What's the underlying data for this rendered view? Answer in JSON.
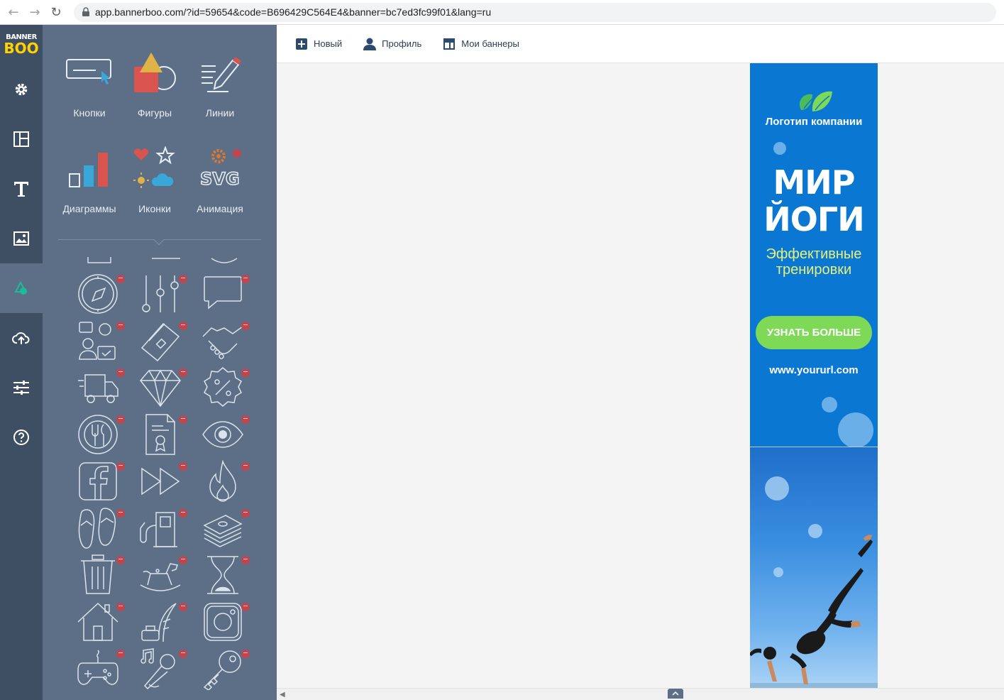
{
  "browser": {
    "url": "app.bannerboo.com/?id=59654&code=B696429C564E4&banner=bc7ed3fc99f01&lang=ru"
  },
  "logo": {
    "line1": "BANNER",
    "line2": "BOO"
  },
  "rail": {
    "items": [
      {
        "icon": "gear-icon"
      },
      {
        "icon": "layout-icon"
      },
      {
        "icon": "text-icon"
      },
      {
        "icon": "image-icon"
      },
      {
        "icon": "shapes-icon",
        "active": true
      },
      {
        "icon": "upload-cloud-icon"
      },
      {
        "icon": "sliders-icon"
      },
      {
        "icon": "help-icon"
      }
    ]
  },
  "panel": {
    "categories": [
      {
        "label": "Кнопки",
        "icon": "button-cursor-icon"
      },
      {
        "label": "Фигуры",
        "icon": "shapes-icon"
      },
      {
        "label": "Линии",
        "icon": "pencil-lines-icon"
      },
      {
        "label": "Диаграммы",
        "icon": "bar-chart-icon"
      },
      {
        "label": "Иконки",
        "icon": "icons-set-icon"
      },
      {
        "label": "Анимация",
        "icon": "svg-animation-icon"
      }
    ],
    "icons": [
      "compass-icon",
      "equalizer-icon",
      "chat-bubble-icon",
      "support-team-icon",
      "credit-card-icon",
      "handshake-icon",
      "delivery-truck-icon",
      "diamond-icon",
      "discount-icon",
      "restaurant-icon",
      "certificate-icon",
      "eye-icon",
      "facebook-icon",
      "fast-forward-icon",
      "flame-icon",
      "flip-flops-icon",
      "gas-station-icon",
      "money-stack-icon",
      "trash-icon",
      "rocking-horse-icon",
      "hourglass-icon",
      "house-icon",
      "ink-feather-icon",
      "instagram-icon",
      "gamepad-icon",
      "karaoke-icon",
      "key-icon"
    ]
  },
  "toolbar": {
    "new_label": "Новый",
    "profile_label": "Профиль",
    "banners_label": "Мои баннеры"
  },
  "banner": {
    "logo_text": "Логотип компании",
    "title_line1": "МИР",
    "title_line2": "ЙОГИ",
    "subtitle_line1": "Эффективные",
    "subtitle_line2": "тренировки",
    "cta": "УЗНАТЬ БОЛЬШЕ",
    "url": "www.yoururl.com",
    "colors": {
      "background": "#0a78d2",
      "cta": "#7ed957",
      "subtitle": "#e7f07a"
    }
  },
  "colors": {
    "rail": "#3f4f63",
    "panel": "#5c6f87",
    "accent": "#1abc9c"
  }
}
